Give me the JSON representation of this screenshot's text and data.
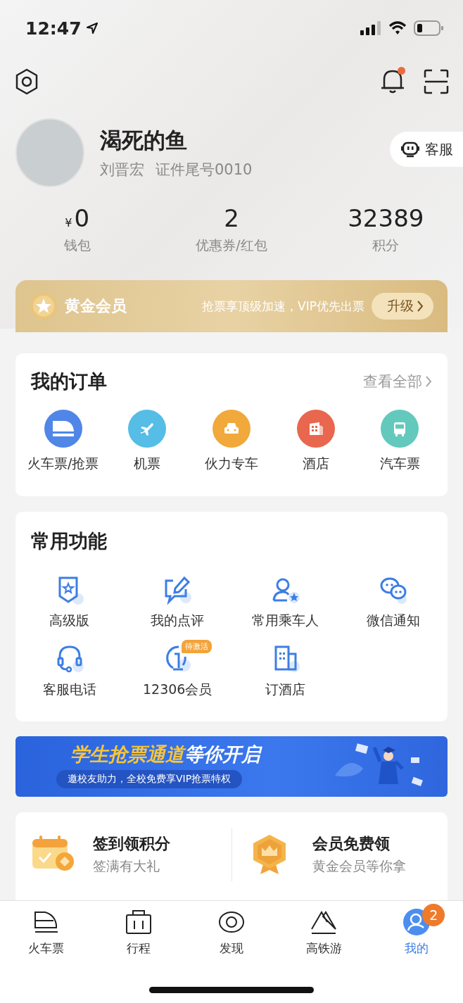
{
  "status_bar": {
    "time": "12:47"
  },
  "header": {
    "notification_unread": true
  },
  "profile": {
    "nickname": "渴死的鱼",
    "real_name": "刘晋宏",
    "id_note": "证件尾号0010",
    "service_button": "客服"
  },
  "stats": [
    {
      "prefix": "¥",
      "value": "0",
      "label": "钱包"
    },
    {
      "value": "2",
      "label": "优惠券/红包"
    },
    {
      "value": "32389",
      "label": "积分"
    }
  ],
  "membership": {
    "title": "黄金会员",
    "slogan": "抢票享顶级加速，VIP优先出票",
    "button": "升级"
  },
  "orders": {
    "title": "我的订单",
    "view_all": "查看全部",
    "items": [
      {
        "label": "火车票/抢票",
        "kind": "train",
        "color": "#4f86e8"
      },
      {
        "label": "机票",
        "kind": "plane",
        "color": "#55bde6"
      },
      {
        "label": "伙力专车",
        "kind": "car",
        "color": "#f0a93a"
      },
      {
        "label": "酒店",
        "kind": "hotel",
        "color": "#e8674e"
      },
      {
        "label": "汽车票",
        "kind": "bus",
        "color": "#63c9bd"
      }
    ]
  },
  "functions": {
    "title": "常用功能",
    "items": [
      {
        "label": "高级版",
        "kind": "shield"
      },
      {
        "label": "我的点评",
        "kind": "review"
      },
      {
        "label": "常用乘车人",
        "kind": "person"
      },
      {
        "label": "微信通知",
        "kind": "chat"
      },
      {
        "label": "客服电话",
        "kind": "headset"
      },
      {
        "label": "12306会员",
        "kind": "member",
        "badge": "待激活"
      },
      {
        "label": "订酒店",
        "kind": "building"
      }
    ]
  },
  "banner": {
    "headline_1": "学生抢票通道",
    "headline_2": "等你开启",
    "subtitle": "邀校友助力，全校免费享VIP抢票特权"
  },
  "tasks": [
    {
      "title": "签到领积分",
      "subtitle": "签满有大礼",
      "kind": "calendar"
    },
    {
      "title": "会员免费领",
      "subtitle": "黄金会员等你拿",
      "kind": "medal"
    }
  ],
  "tab_bar": [
    {
      "label": "火车票",
      "kind": "train",
      "selected": false
    },
    {
      "label": "行程",
      "kind": "suitcase",
      "selected": false
    },
    {
      "label": "发现",
      "kind": "eye",
      "selected": false
    },
    {
      "label": "高铁游",
      "kind": "mountain",
      "selected": false
    },
    {
      "label": "我的",
      "kind": "user",
      "selected": true,
      "badge": "2"
    }
  ]
}
